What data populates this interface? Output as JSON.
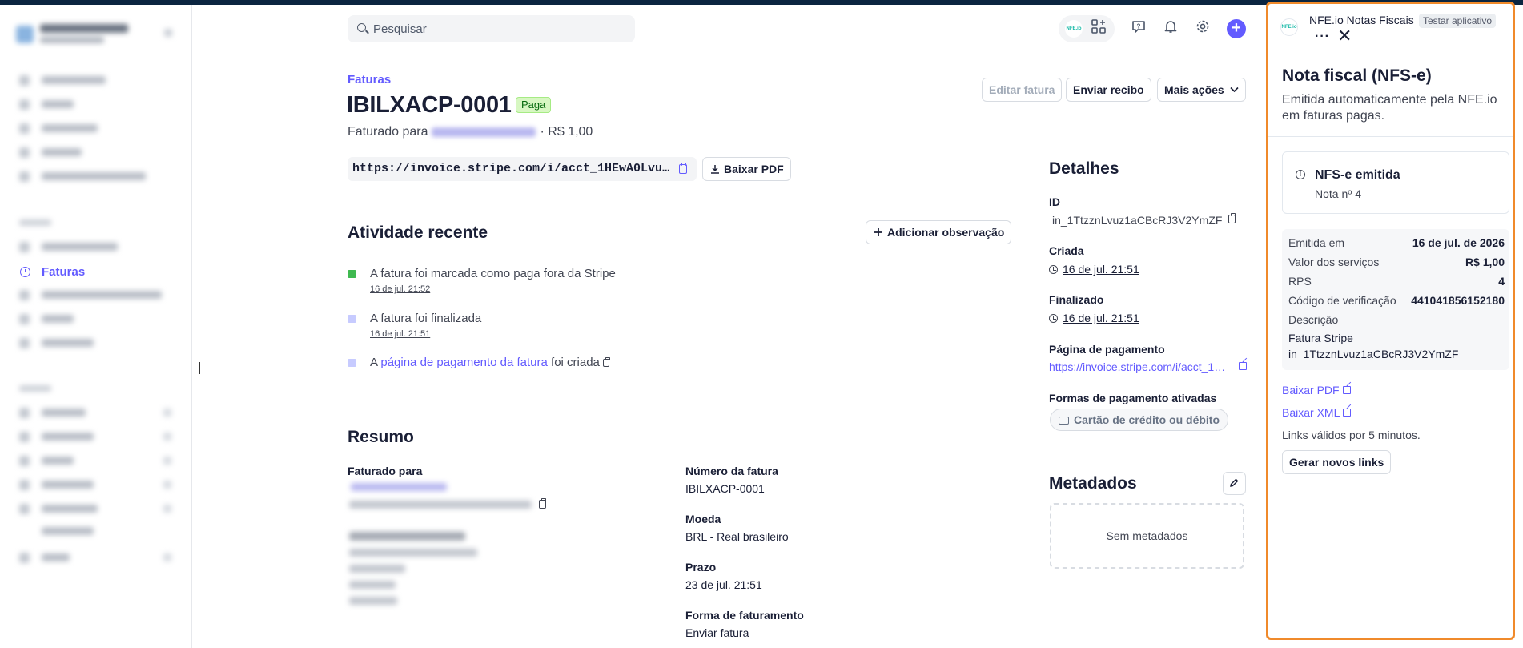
{
  "header": {
    "search_placeholder": "Pesquisar",
    "app_pill_logo": "NFE.io",
    "icons": [
      "apps-add-icon",
      "help-icon",
      "bell-icon",
      "gear-icon",
      "plus-icon"
    ]
  },
  "sidebar": {
    "active_item": "Faturas"
  },
  "invoice": {
    "breadcrumb": "Faturas",
    "number": "IBILXACP-0001",
    "status": "Paga",
    "billed_prefix": "Faturado para",
    "amount_suffix": "· R$ 1,00",
    "actions": {
      "edit": "Editar fatura",
      "send_receipt": "Enviar recibo",
      "more": "Mais ações"
    },
    "url": "https://invoice.stripe.com/i/acct_1HEwA0Lvuz1a…",
    "download_pdf": "Baixar PDF"
  },
  "activity": {
    "title": "Atividade recente",
    "add_note": "Adicionar observação",
    "items": [
      {
        "text": "A fatura foi marcada como paga fora da Stripe",
        "date": "16 de jul. 21:52",
        "icon": "cash-icon",
        "color": "#3fb950"
      },
      {
        "text": "A fatura foi finalizada",
        "date": "16 de jul. 21:51",
        "icon": "document-icon",
        "color": "#a5b4fc"
      },
      {
        "text_before": "A ",
        "link": "página de pagamento da fatura",
        "text_after": " foi criada",
        "icon": "document-icon",
        "color": "#a5b4fc"
      }
    ]
  },
  "summary": {
    "title": "Resumo",
    "billed_to_label": "Faturado para",
    "invoice_number_label": "Número da fatura",
    "invoice_number": "IBILXACP-0001",
    "currency_label": "Moeda",
    "currency": "BRL - Real brasileiro",
    "due_label": "Prazo",
    "due": "23 de jul. 21:51",
    "billing_method_label": "Forma de faturamento",
    "billing_method": "Enviar fatura"
  },
  "details": {
    "title": "Detalhes",
    "id_label": "ID",
    "id": "in_1TtzznLvuz1aCBcRJ3V2YmZF",
    "created_label": "Criada",
    "created": "16 de jul. 21:51",
    "finalized_label": "Finalizado",
    "finalized": "16 de jul. 21:51",
    "payment_page_label": "Página de pagamento",
    "payment_page": "https://invoice.stripe.com/i/acct_1…",
    "payment_methods_label": "Formas de pagamento ativadas",
    "payment_method": "Cartão de crédito ou débito"
  },
  "metadata": {
    "title": "Metadados",
    "empty": "Sem metadados"
  },
  "panel": {
    "app_name": "NFE.io Notas Fiscais",
    "test_badge": "Testar aplicativo",
    "more": "···",
    "close": "✕",
    "title": "Nota fiscal (NFS-e)",
    "description": "Emitida automaticamente pela NFE.io em faturas pagas.",
    "status_title": "NFS-e emitida",
    "status_sub": "Nota nº 4",
    "rows": [
      {
        "k": "Emitida em",
        "v": "16 de jul. de 2026"
      },
      {
        "k": "Valor dos serviços",
        "v": "R$ 1,00"
      },
      {
        "k": "RPS",
        "v": "4"
      },
      {
        "k": "Código de verificação",
        "v": "441041856152180"
      }
    ],
    "description_label": "Descrição",
    "description_value": "Fatura Stripe in_1TtzznLvuz1aCBcRJ3V2YmZF",
    "download_pdf": "Baixar PDF",
    "download_xml": "Baixar XML",
    "links_note": "Links válidos por 5 minutos.",
    "generate_links": "Gerar novos links"
  },
  "colors": {
    "accent": "#635bff",
    "panel_border": "#f08a2b",
    "paid_badge_bg": "#d7f7c2"
  }
}
